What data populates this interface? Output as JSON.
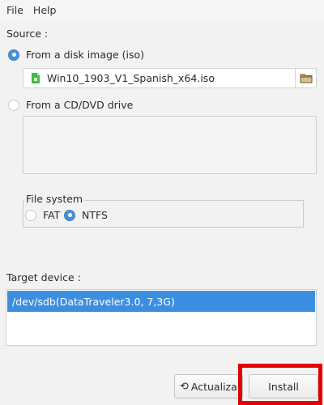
{
  "menu": {
    "file": "File",
    "help": "Help"
  },
  "source": {
    "label": "Source :",
    "disk_image_option": {
      "label": "From a disk image (iso)",
      "checked": true
    },
    "iso_file": "Win10_1903_V1_Spanish_x64.iso",
    "cd_option": {
      "label": "From a CD/DVD drive",
      "checked": false
    }
  },
  "filesystem": {
    "title": "File system",
    "fat": {
      "label": "FAT",
      "checked": false
    },
    "ntfs": {
      "label": "NTFS",
      "checked": true
    }
  },
  "target": {
    "label": "Target device :",
    "devices": [
      "/dev/sdb(DataTraveler3.0,  7,3G)"
    ]
  },
  "buttons": {
    "refresh": "Actualizar",
    "install": "Install"
  },
  "colors": {
    "accent": "#4a90d9",
    "selection": "#3c8fe0",
    "highlight": "#e00000",
    "iso_icon": "#3cc23c"
  }
}
